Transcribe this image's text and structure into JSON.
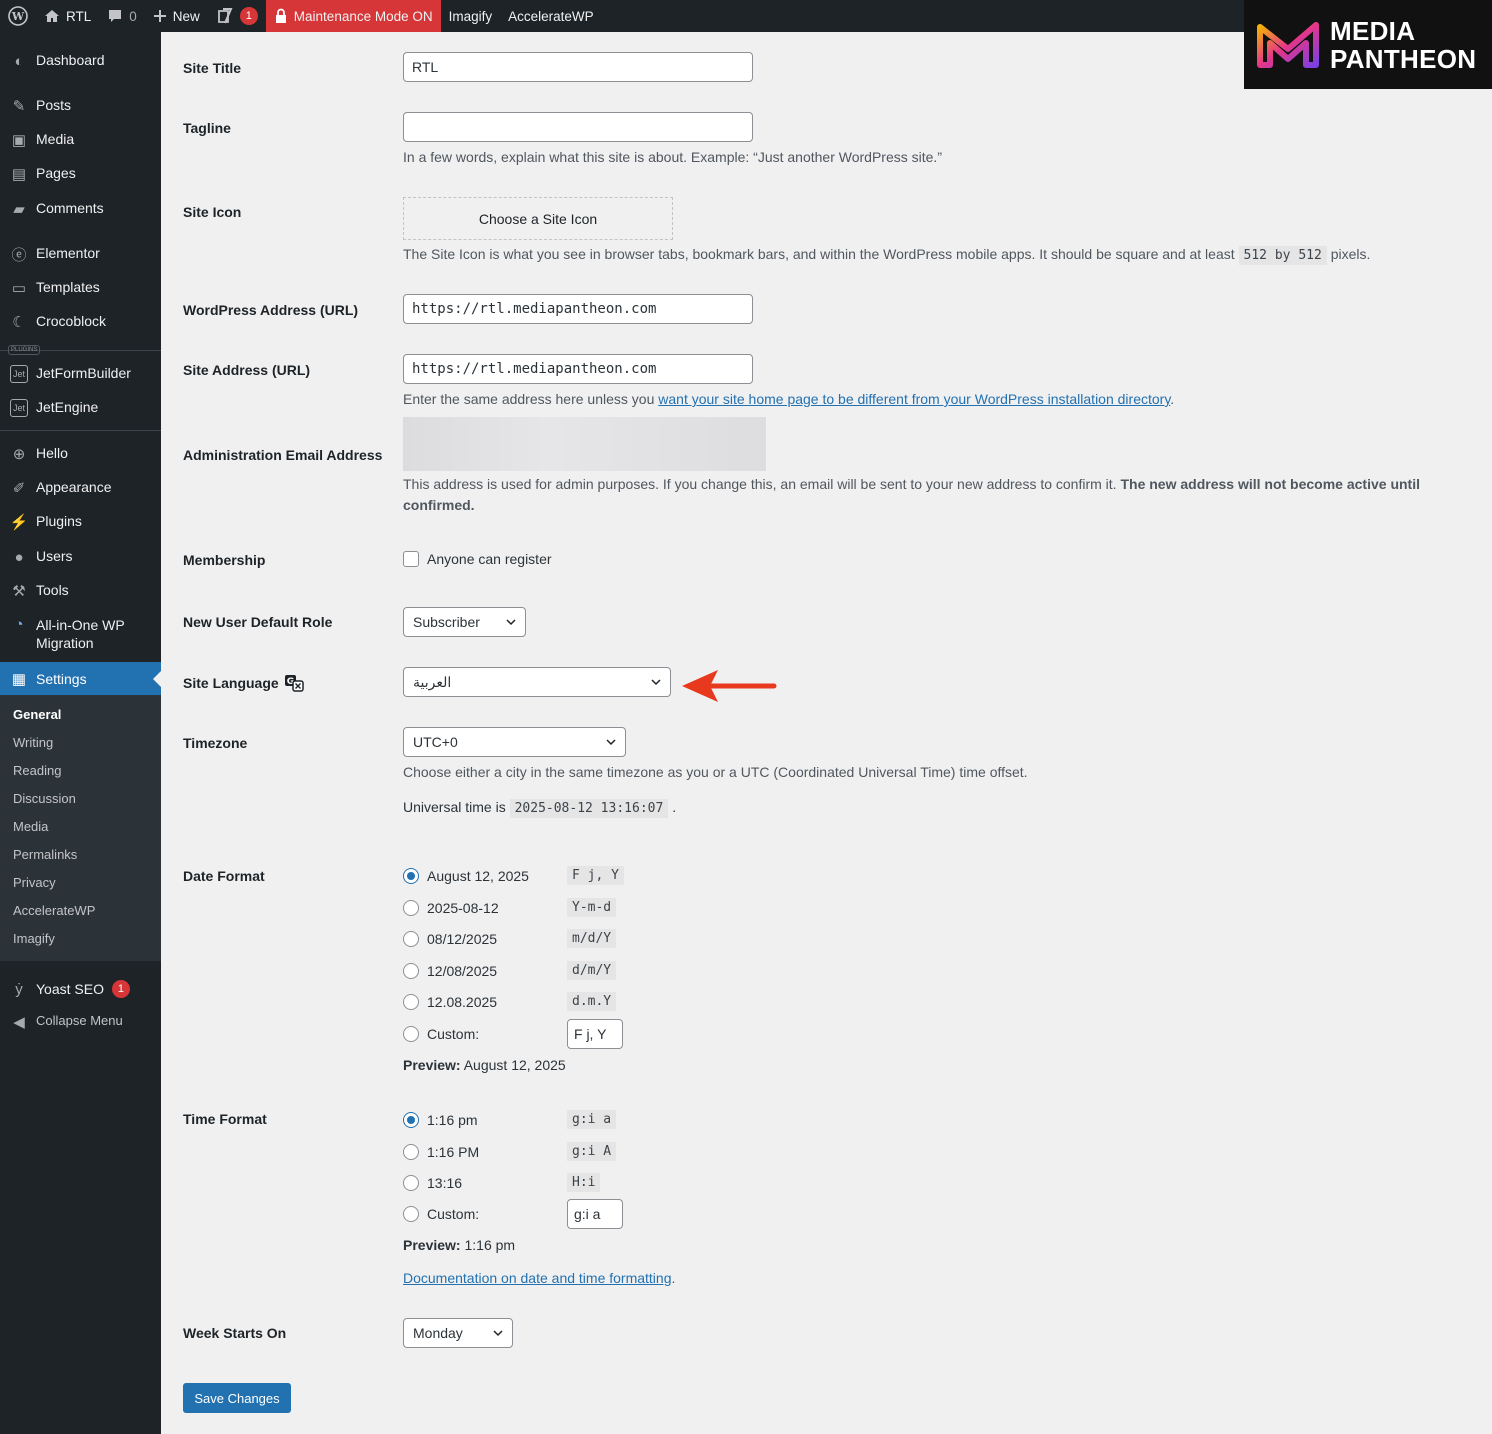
{
  "adminbar": {
    "site_name": "RTL",
    "comments_count": "0",
    "new_label": "New",
    "yoast_count": "1",
    "maintenance_label": "Maintenance Mode ON",
    "imagify_label": "Imagify",
    "accelerate_label": "AccelerateWP"
  },
  "logo": {
    "line1": "MEDIA",
    "line2": "PANTHEON"
  },
  "sidebar": {
    "items": [
      {
        "label": "Dashboard"
      },
      {
        "label": "Posts"
      },
      {
        "label": "Media"
      },
      {
        "label": "Pages"
      },
      {
        "label": "Comments"
      },
      {
        "label": "Elementor"
      },
      {
        "label": "Templates"
      },
      {
        "label": "Crocoblock"
      },
      {
        "label": "PLUGINS"
      },
      {
        "label": "JetFormBuilder"
      },
      {
        "label": "JetEngine"
      },
      {
        "label": "Hello"
      },
      {
        "label": "Appearance"
      },
      {
        "label": "Plugins"
      },
      {
        "label": "Users"
      },
      {
        "label": "Tools"
      },
      {
        "label": "All-in-One WP Migration"
      },
      {
        "label": "Settings"
      }
    ],
    "submenu": [
      "General",
      "Writing",
      "Reading",
      "Discussion",
      "Media",
      "Permalinks",
      "Privacy",
      "AccelerateWP",
      "Imagify"
    ],
    "yoast_label": "Yoast SEO",
    "yoast_count": "1",
    "collapse_label": "Collapse Menu"
  },
  "form": {
    "site_title_label": "Site Title",
    "site_title_value": "RTL",
    "tagline_label": "Tagline",
    "tagline_value": "",
    "tagline_desc": "In a few words, explain what this site is about. Example: “Just another WordPress site.”",
    "site_icon_label": "Site Icon",
    "site_icon_button": "Choose a Site Icon",
    "site_icon_desc_1": "The Site Icon is what you see in browser tabs, bookmark bars, and within the WordPress mobile apps. It should be square and at least",
    "site_icon_code_1": "512",
    "site_icon_by": "by",
    "site_icon_code_2": "512",
    "site_icon_desc_2": "pixels.",
    "wp_address_label": "WordPress Address (URL)",
    "wp_address_value": "https://rtl.mediapantheon.com",
    "site_address_label": "Site Address (URL)",
    "site_address_value": "https://rtl.mediapantheon.com",
    "site_address_desc_1": "Enter the same address here unless you",
    "site_address_link": "want your site home page to be different from your WordPress installation directory",
    "site_address_desc_2": ".",
    "admin_email_label": "Administration Email Address",
    "admin_email_desc_1": "This address is used for admin purposes. If you change this, an email will be sent to your new address to confirm it.",
    "admin_email_desc_bold": "The new address will not become active until confirmed.",
    "membership_label": "Membership",
    "membership_checkbox": "Anyone can register",
    "default_role_label": "New User Default Role",
    "default_role_value": "Subscriber",
    "site_language_label": "Site Language",
    "site_language_value": "العربية",
    "timezone_label": "Timezone",
    "timezone_value": "UTC+0",
    "timezone_desc": "Choose either a city in the same timezone as you or a UTC (Coordinated Universal Time) time offset.",
    "universal_time_label": "Universal time is",
    "universal_time_value": "2025-08-12 13:16:07",
    "universal_time_end": ".",
    "date_format_label": "Date Format",
    "date_formats": [
      {
        "label": "August 12, 2025",
        "code": "F j, Y",
        "checked": true
      },
      {
        "label": "2025-08-12",
        "code": "Y-m-d",
        "checked": false
      },
      {
        "label": "08/12/2025",
        "code": "m/d/Y",
        "checked": false
      },
      {
        "label": "12/08/2025",
        "code": "d/m/Y",
        "checked": false
      },
      {
        "label": "12.08.2025",
        "code": "d.m.Y",
        "checked": false
      }
    ],
    "custom_label": "Custom:",
    "date_custom_value": "F j, Y",
    "preview_label": "Preview:",
    "date_preview_value": "August 12, 2025",
    "time_format_label": "Time Format",
    "time_formats": [
      {
        "label": "1:16 pm",
        "code": "g:i a",
        "checked": true
      },
      {
        "label": "1:16 PM",
        "code": "g:i A",
        "checked": false
      },
      {
        "label": "13:16",
        "code": "H:i",
        "checked": false
      }
    ],
    "time_custom_value": "g:i a",
    "time_preview_value": "1:16 pm",
    "doc_link": "Documentation on date and time formatting",
    "doc_end": ".",
    "week_starts_label": "Week Starts On",
    "week_starts_value": "Monday",
    "save_button": "Save Changes"
  },
  "colors": {
    "accent": "#2271b1",
    "arrow": "#e8391f",
    "adminbar": "#1d2327"
  }
}
